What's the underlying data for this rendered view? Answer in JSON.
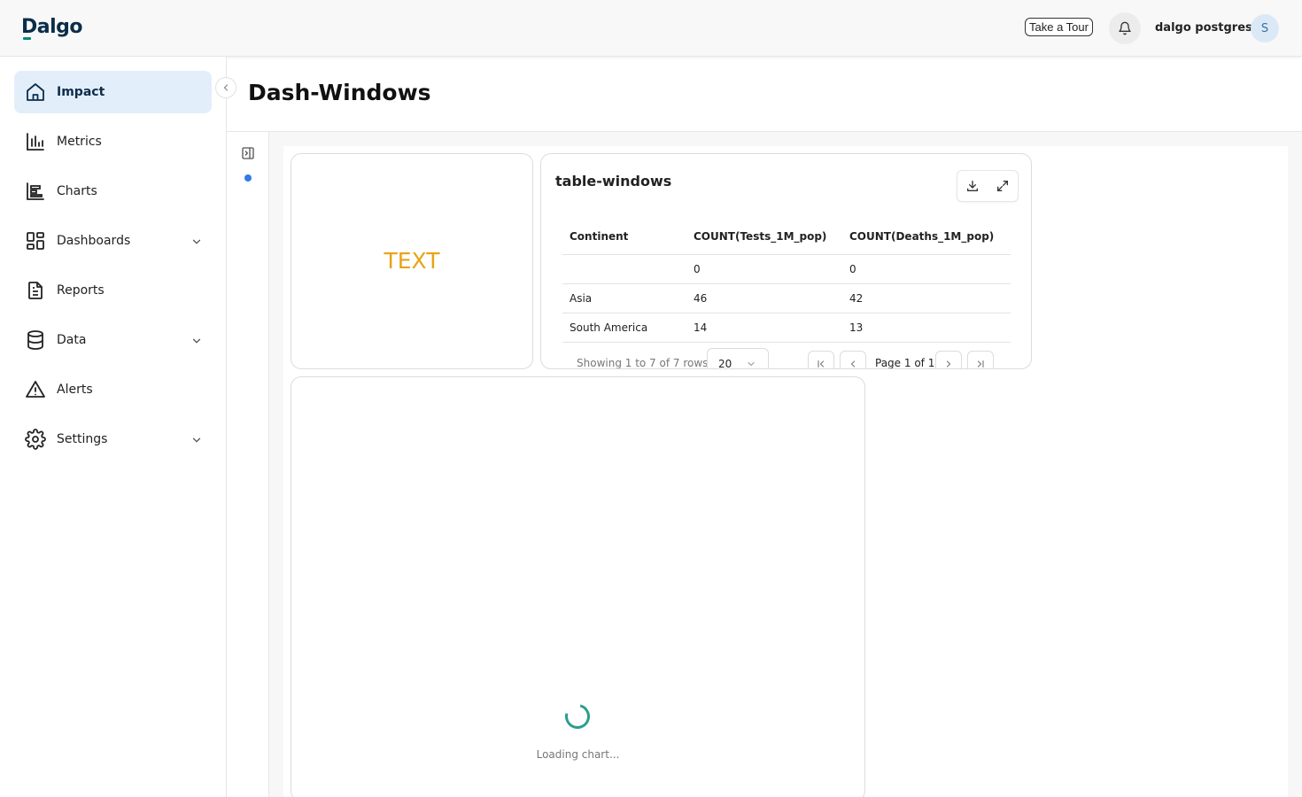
{
  "header": {
    "logo": "Dalgo",
    "tour_label": "Take a Tour",
    "user_name": "dalgo postgres",
    "avatar_initial": "S"
  },
  "sidebar": {
    "items": [
      {
        "label": "Impact",
        "icon": "home-icon",
        "active": true,
        "expandable": false
      },
      {
        "label": "Metrics",
        "icon": "bar-chart-icon",
        "active": false,
        "expandable": false
      },
      {
        "label": "Charts",
        "icon": "charts-icon",
        "active": false,
        "expandable": false
      },
      {
        "label": "Dashboards",
        "icon": "dashboard-grid-icon",
        "active": false,
        "expandable": true
      },
      {
        "label": "Reports",
        "icon": "document-icon",
        "active": false,
        "expandable": false
      },
      {
        "label": "Data",
        "icon": "database-icon",
        "active": false,
        "expandable": true
      },
      {
        "label": "Alerts",
        "icon": "warning-icon",
        "active": false,
        "expandable": false
      },
      {
        "label": "Settings",
        "icon": "gear-icon",
        "active": false,
        "expandable": true
      }
    ]
  },
  "page": {
    "title": "Dash-Windows"
  },
  "text_widget": {
    "value": "TEXT",
    "color": "#e8a317"
  },
  "table_widget": {
    "title": "table-windows",
    "columns": [
      "Continent",
      "COUNT(Tests_1M_pop)",
      "COUNT(Deaths_1M_pop)"
    ],
    "rows": [
      [
        "",
        "0",
        "0"
      ],
      [
        "Asia",
        "46",
        "42"
      ],
      [
        "South America",
        "14",
        "13"
      ]
    ],
    "pagination": {
      "info": "Showing 1 to 7 of 7 rows",
      "page_size": "20",
      "page_label": "Page 1 of 1"
    }
  },
  "chart_widget": {
    "loading_text": "Loading chart..."
  },
  "colors": {
    "accent": "#2f7be6",
    "active_nav_bg": "#e3eefb",
    "spinner": "#2a9d8f"
  }
}
